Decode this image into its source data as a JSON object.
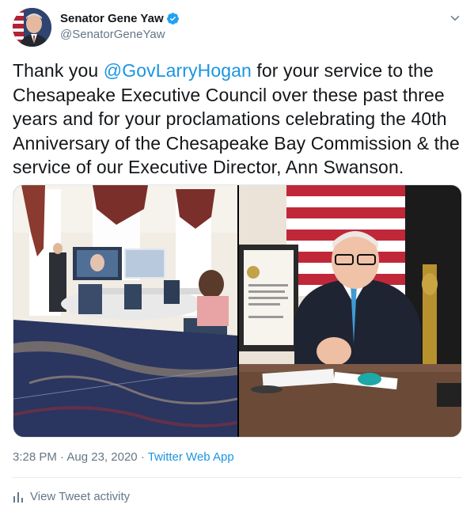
{
  "author": {
    "display_name": "Senator Gene Yaw",
    "handle": "@SenatorGeneYaw",
    "verified": true
  },
  "tweet": {
    "text_before_mention": "Thank you ",
    "mention": "@GovLarryHogan",
    "text_after_mention": " for your service to the Chesapeake Executive Council over these past three years and for your proclamations celebrating the 40th Anniversary of the Chesapeake Bay Commission & the service of our Executive Director, Ann Swanson."
  },
  "meta": {
    "time": "3:28 PM",
    "separator": "·",
    "date": "Aug 23, 2020",
    "app": "Twitter Web App"
  },
  "activity": {
    "label": "View Tweet activity",
    "icon": "bar-chart-icon"
  },
  "icons": {
    "verified": "verified-badge-icon",
    "more": "chevron-down-icon"
  },
  "colors": {
    "text": "#14171a",
    "secondary": "#657786",
    "link": "#1b95e0",
    "divider": "#e6ecf0"
  }
}
